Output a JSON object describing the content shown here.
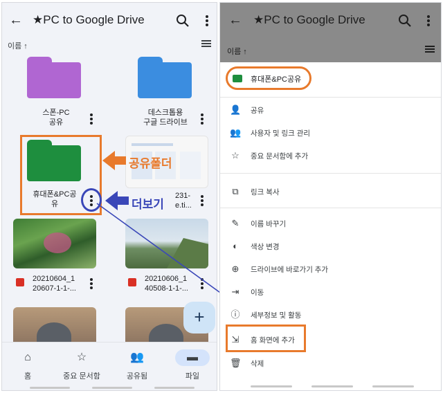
{
  "left": {
    "title": "★PC to Google Drive",
    "back_glyph": "←",
    "sort_label": "이름 ↑",
    "folders": [
      {
        "name_line1": "스폰-PC",
        "name_line2": "공유",
        "color": "#b066d2"
      },
      {
        "name_line1": "데스크톱용",
        "name_line2": "구글 드라이브",
        "color": "#3b8de0"
      },
      {
        "name_line1": "휴대폰&PC공",
        "name_line2": "유",
        "color": "#1e8e3e"
      }
    ],
    "doc_item": {
      "name_line1": "231-",
      "name_line2": "e.ti..."
    },
    "photos": [
      {
        "name_line1": "20210604_1",
        "name_line2": "20607-1-1-..."
      },
      {
        "name_line1": "20210606_1",
        "name_line2": "40508-1-1-..."
      }
    ],
    "callout_share": "공유폴더",
    "callout_more": "더보기",
    "fab_glyph": "+",
    "nav": [
      {
        "label": "홈",
        "icon": "⌂"
      },
      {
        "label": "중요 문서함",
        "icon": "☆"
      },
      {
        "label": "공유됨",
        "icon": "👥"
      },
      {
        "label": "파일",
        "icon": "▬"
      }
    ]
  },
  "right": {
    "title": "★PC to Google Drive",
    "back_glyph": "←",
    "sort_label": "이름 ↑",
    "folder_label": "휴대폰&PC공유",
    "menu": [
      {
        "icon": "👤",
        "label": "공유"
      },
      {
        "icon": "👥",
        "label": "사용자 및 링크 관리"
      },
      {
        "icon": "☆",
        "label": "중요 문서함에 추가"
      },
      {
        "icon": "⧉",
        "label": "링크 복사"
      },
      {
        "icon": "✎",
        "label": "이름 바꾸기"
      },
      {
        "icon": "◐",
        "label": "색상 변경"
      },
      {
        "icon": "⊕",
        "label": "드라이브에 바로가기 추가"
      },
      {
        "icon": "⇥",
        "label": "이동"
      },
      {
        "icon": "ⓘ",
        "label": "세부정보 및 활동"
      },
      {
        "icon": "⇲",
        "label": "홈 화면에 추가"
      },
      {
        "icon": "🗑",
        "label": "삭제"
      }
    ]
  },
  "colors": {
    "highlight": "#e87a2c",
    "pointer": "#3a47b8"
  }
}
